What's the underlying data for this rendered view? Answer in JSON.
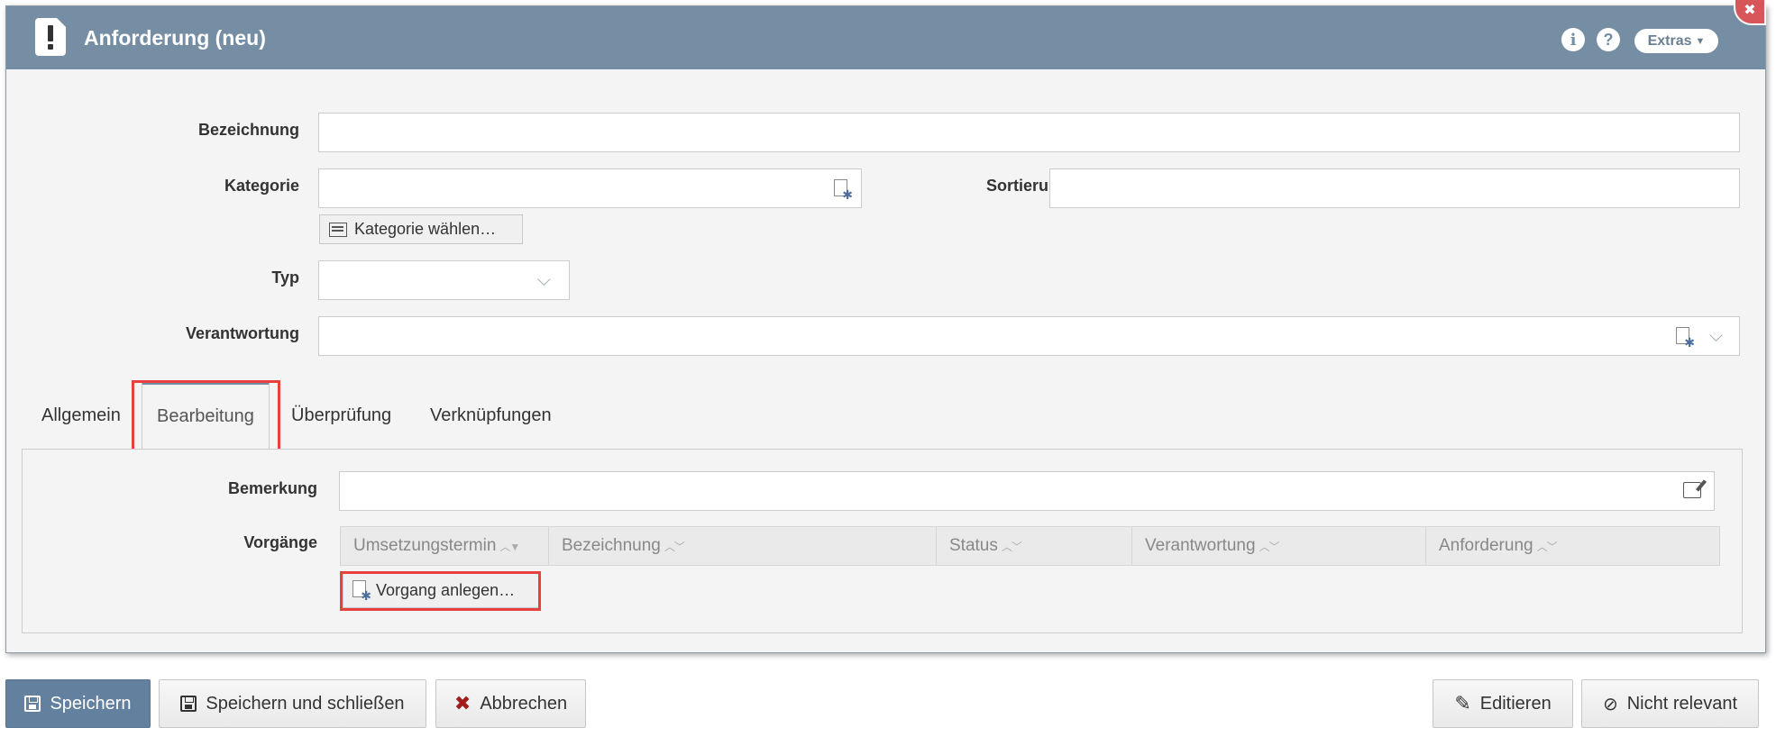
{
  "window": {
    "title": "Anforderung (neu)",
    "info_icon": "info-icon",
    "help_icon": "help-icon",
    "extras_label": "Extras",
    "close_label": "✖"
  },
  "form": {
    "bezeichnung": {
      "label": "Bezeichnung",
      "value": ""
    },
    "kategorie": {
      "label": "Kategorie",
      "value": "",
      "choose_label": "Kategorie wählen…"
    },
    "sortierung": {
      "label": "Sortierung",
      "value": ""
    },
    "typ": {
      "label": "Typ",
      "value": ""
    },
    "verantwortung": {
      "label": "Verantwortung",
      "value": ""
    }
  },
  "tabs": [
    {
      "label": "Allgemein",
      "active": false
    },
    {
      "label": "Bearbeitung",
      "active": true
    },
    {
      "label": "Überprüfung",
      "active": false
    },
    {
      "label": "Verknüpfungen",
      "active": false
    }
  ],
  "bearbeitung": {
    "bemerkung": {
      "label": "Bemerkung",
      "value": ""
    },
    "vorgaenge": {
      "label": "Vorgänge",
      "columns": [
        "Umsetzungstermin",
        "Bezeichnung",
        "Status",
        "Verantwortung",
        "Anforderung"
      ],
      "create_label": "Vorgang anlegen…"
    }
  },
  "footer": {
    "save": "Speichern",
    "save_close": "Speichern und schließen",
    "cancel": "Abbrechen",
    "edit": "Editieren",
    "not_relevant": "Nicht relevant"
  },
  "colors": {
    "titlebar": "#768ea4",
    "primary_button": "#64809f",
    "highlight": "#e8403f"
  }
}
